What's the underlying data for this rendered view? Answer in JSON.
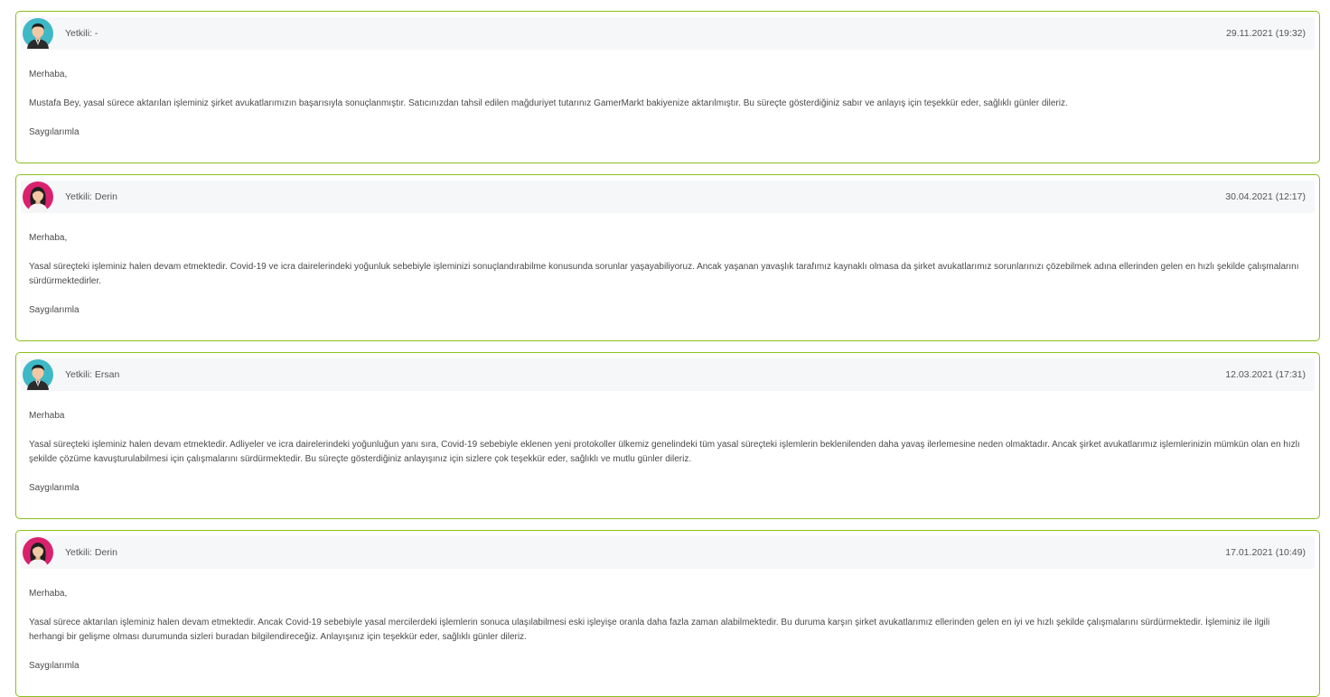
{
  "accent_color": "#8bbf1f",
  "messages": [
    {
      "avatar": "male-agent-icon",
      "author": "Yetkili: -",
      "date": "29.11.2021 (19:32)",
      "greeting": "Merhaba,",
      "body": "Mustafa Bey, yasal sürece aktarılan işleminiz şirket avukatlarımızın başarısıyla sonuçlanmıştır. Satıcınızdan tahsil edilen mağduriyet tutarınız GamerMarkt bakiyenize aktarılmıştır. Bu süreçte gösterdiğiniz sabır ve anlayış için teşekkür eder, sağlıklı günler dileriz.",
      "closing": "Saygılarımla"
    },
    {
      "avatar": "female-agent-icon",
      "author": "Yetkili: Derin",
      "date": "30.04.2021 (12:17)",
      "greeting": "Merhaba,",
      "body": "Yasal süreçteki işleminiz halen devam etmektedir. Covid-19 ve icra dairelerindeki yoğunluk sebebiyle işleminizi sonuçlandırabilme konusunda sorunlar yaşayabiliyoruz. Ancak yaşanan yavaşlık tarafımız kaynaklı olmasa da şirket avukatlarımız sorunlarınızı çözebilmek adına ellerinden gelen en hızlı şekilde çalışmalarını sürdürmektedirler.",
      "closing": "Saygılarımla"
    },
    {
      "avatar": "male-agent-icon",
      "author": "Yetkili: Ersan",
      "date": "12.03.2021 (17:31)",
      "greeting": "Merhaba",
      "body": "Yasal süreçteki işleminiz halen devam etmektedir. Adliyeler ve icra dairelerindeki yoğunluğun yanı sıra, Covid-19 sebebiyle eklenen yeni protokoller ülkemiz genelindeki tüm yasal süreçteki işlemlerin beklenilenden daha yavaş ilerlemesine neden olmaktadır. Ancak şirket avukatlarımız işlemlerinizin mümkün olan en hızlı şekilde çözüme kavuşturulabilmesi için çalışmalarını sürdürmektedir. Bu süreçte gösterdiğiniz anlayışınız için sizlere çok teşekkür eder, sağlıklı ve mutlu günler dileriz.",
      "closing": "Saygılarımla"
    },
    {
      "avatar": "female-agent-icon",
      "author": "Yetkili: Derin",
      "date": "17.01.2021 (10:49)",
      "greeting": "Merhaba,",
      "body": "Yasal sürece aktarılan işleminiz halen devam etmektedir. Ancak Covid-19 sebebiyle yasal mercilerdeki işlemlerin sonuca ulaşılabilmesi eski işleyişe oranla daha fazla zaman alabilmektedir. Bu duruma karşın şirket avukatlarımız ellerinden gelen en iyi ve hızlı şekilde çalışmalarını sürdürmektedir. İşleminiz ile ilgili herhangi bir gelişme olması durumunda sizleri buradan bilgilendireceğiz. Anlayışınız için teşekkür eder, sağlıklı günler dileriz.",
      "closing": "Saygılarımla"
    }
  ]
}
